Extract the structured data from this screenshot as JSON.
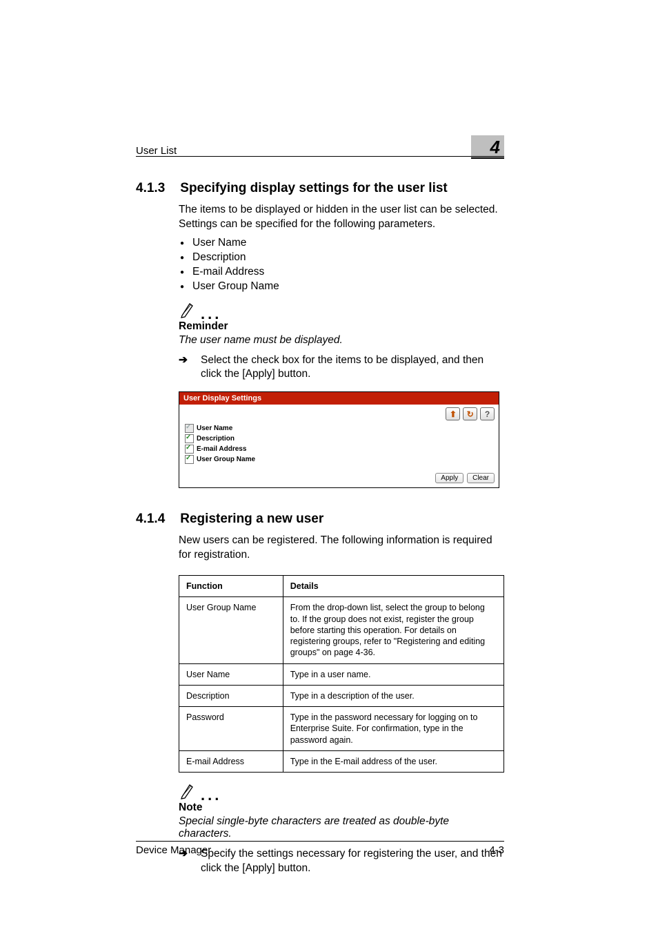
{
  "page": {
    "running_title": "User List",
    "chapter_number": "4",
    "footer_left": "Device Manager",
    "footer_right": "4-3"
  },
  "sec1": {
    "num": "4.1.3",
    "title": "Specifying display settings for the user list",
    "intro": "The items to be displayed or hidden in the user list can be selected. Settings can be specified for the following parameters.",
    "bullets": [
      "User Name",
      "Description",
      "E-mail Address",
      "User Group Name"
    ],
    "reminder_label": "Reminder",
    "reminder_text": "The user name must be displayed.",
    "arrow_text": "Select the check box for the items to be displayed, and then click the [Apply] button."
  },
  "shot": {
    "title": "User Display Settings",
    "options": [
      {
        "label": "User Name",
        "disabled": true
      },
      {
        "label": "Description",
        "disabled": false
      },
      {
        "label": "E-mail Address",
        "disabled": false
      },
      {
        "label": "User Group Name",
        "disabled": false
      }
    ],
    "icon_up": "⬆",
    "icon_refresh": "↻",
    "icon_help": "?",
    "btn_apply": "Apply",
    "btn_clear": "Clear"
  },
  "sec2": {
    "num": "4.1.4",
    "title": "Registering a new user",
    "intro": "New users can be registered. The following information is required for registration.",
    "table_head": [
      "Function",
      "Details"
    ],
    "rows": [
      {
        "f": "User Group Name",
        "d": "From the drop-down list, select the group to belong to. If the group does not exist, register the group before starting this operation. For details on registering groups, refer to \"Registering and editing groups\" on page 4-36."
      },
      {
        "f": "User Name",
        "d": "Type in a user name."
      },
      {
        "f": "Description",
        "d": "Type in a description of the user."
      },
      {
        "f": "Password",
        "d": "Type in the password necessary for logging on to Enterprise Suite. For confirmation, type in the password again."
      },
      {
        "f": "E-mail Address",
        "d": "Type in the E-mail address of the user."
      }
    ],
    "note_label": "Note",
    "note_text": "Special single-byte characters are treated as double-byte characters.",
    "arrow_text": "Specify the settings necessary for registering the user, and then click the [Apply] button."
  }
}
